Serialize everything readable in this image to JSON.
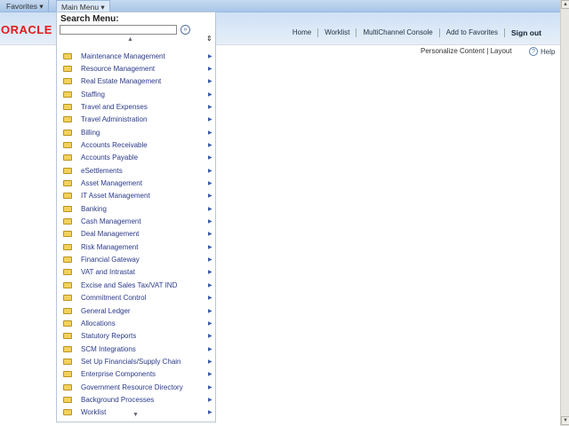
{
  "topbar": {
    "favorites": "Favorites ▾",
    "main_menu": "Main Menu ▾"
  },
  "header": {
    "logo": "ORACLE",
    "nav": [
      "Home",
      "Worklist",
      "MultiChannel Console",
      "Add to Favorites"
    ],
    "sign_out": "Sign out"
  },
  "page": {
    "personalize": "Personalize Content | Layout",
    "help": "Help"
  },
  "menu": {
    "search_label": "Search Menu:",
    "search_value": "",
    "items": [
      "Maintenance Management",
      "Resource Management",
      "Real Estate Management",
      "Staffing",
      "Travel and Expenses",
      "Travel Administration",
      "Billing",
      "Accounts Receivable",
      "Accounts Payable",
      "eSettlements",
      "Asset Management",
      "IT Asset Management",
      "Banking",
      "Cash Management",
      "Deal Management",
      "Risk Management",
      "Financial Gateway",
      "VAT and Intrastat",
      "Excise and Sales Tax/VAT IND",
      "Commitment Control",
      "General Ledger",
      "Allocations",
      "Statutory Reports",
      "SCM Integrations",
      "Set Up Financials/Supply Chain",
      "Enterprise Components",
      "Government Resource Directory",
      "Background Processes",
      "Worklist"
    ]
  }
}
